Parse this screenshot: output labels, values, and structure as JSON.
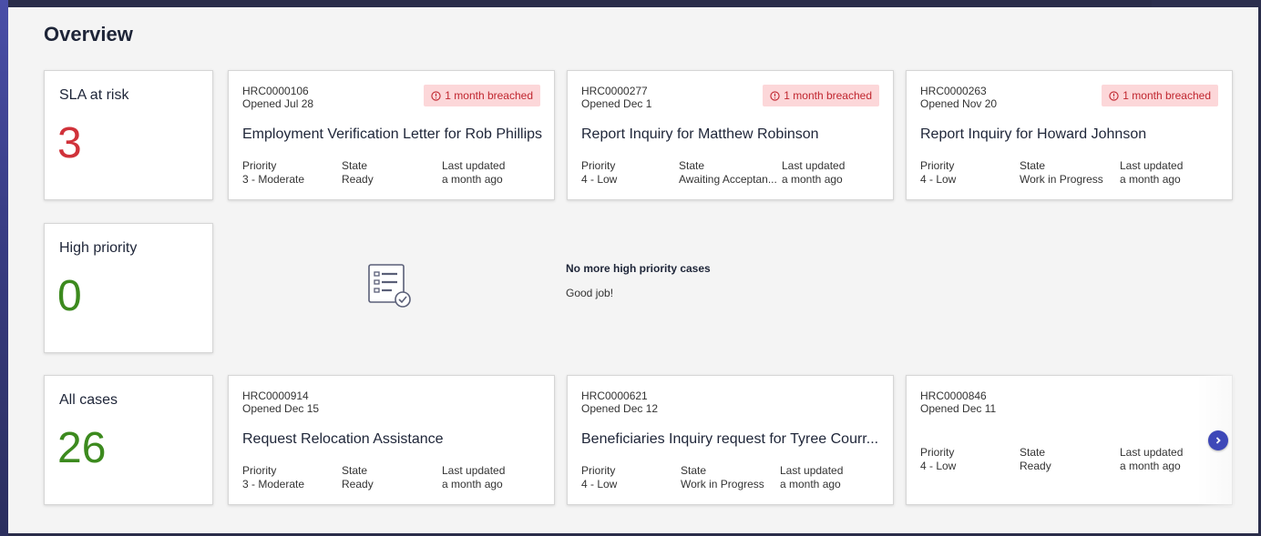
{
  "page": {
    "title": "Overview"
  },
  "colors": {
    "red": "#d0323a",
    "green": "#3c8a1e",
    "badge_bg": "#fcd7d9",
    "badge_fg": "#c0262f",
    "accent": "#3e48b8"
  },
  "field_labels": {
    "priority": "Priority",
    "state": "State",
    "updated": "Last updated"
  },
  "sla": {
    "label": "SLA at risk",
    "count": "3",
    "cases": [
      {
        "number": "HRC0000106",
        "opened": "Opened Jul 28",
        "badge": "1 month breached",
        "title": "Employment Verification Letter for Rob Phillips",
        "priority": "3 - Moderate",
        "state": "Ready",
        "updated": "a month ago"
      },
      {
        "number": "HRC0000277",
        "opened": "Opened Dec 1",
        "badge": "1 month breached",
        "title": "Report Inquiry for Matthew Robinson",
        "priority": "4 - Low",
        "state": "Awaiting Acceptan...",
        "updated": "a month ago"
      },
      {
        "number": "HRC0000263",
        "opened": "Opened Nov 20",
        "badge": "1 month breached",
        "title": "Report Inquiry for Howard Johnson",
        "priority": "4 - Low",
        "state": "Work in Progress",
        "updated": "a month ago"
      }
    ]
  },
  "high": {
    "label": "High priority",
    "count": "0",
    "empty_title": "No more high priority cases",
    "empty_sub": "Good job!",
    "empty_icon": "checklist-icon"
  },
  "all": {
    "label": "All cases",
    "count": "26",
    "cases": [
      {
        "number": "HRC0000914",
        "opened": "Opened Dec 15",
        "title": "Request Relocation Assistance",
        "priority": "3 - Moderate",
        "state": "Ready",
        "updated": "a month ago"
      },
      {
        "number": "HRC0000621",
        "opened": "Opened Dec 12",
        "title": "Beneficiaries Inquiry request for Tyree Courr...",
        "priority": "4 - Low",
        "state": "Work in Progress",
        "updated": "a month ago"
      },
      {
        "number": "HRC0000846",
        "opened": "Opened Dec 11",
        "title": "",
        "priority": "4 - Low",
        "state": "Ready",
        "updated": "a month ago"
      }
    ],
    "next_icon": "chevron-right-icon"
  }
}
